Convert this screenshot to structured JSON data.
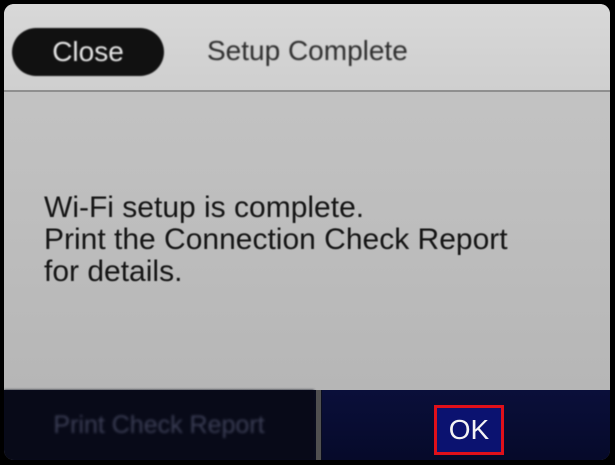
{
  "header": {
    "close_label": "Close",
    "title": "Setup Complete"
  },
  "message": {
    "lines": [
      "Wi-Fi setup is complete.",
      "Print the Connection Check Report",
      "for details."
    ]
  },
  "footer": {
    "left_button_label": "Print Check Report",
    "ok_label": "OK"
  },
  "colors": {
    "screen_background": "#c4c4c4",
    "bottom_bar": "#0a0d1e",
    "highlight": "#e0101a"
  }
}
